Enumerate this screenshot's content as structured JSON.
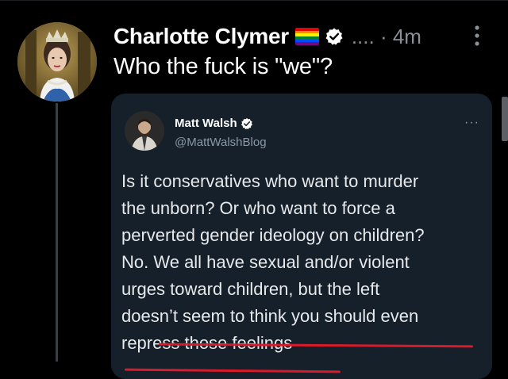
{
  "tweet": {
    "author_name": "Charlotte Clymer",
    "meta": ".... · 4m",
    "text": "Who the fuck is \"we\"?"
  },
  "quoted_tweet": {
    "author_name": "Matt Walsh",
    "handle": "@MattWalshBlog",
    "more": "···",
    "lines": [
      "Is it conservatives who want to murder",
      "the unborn? Or who want to force a",
      "perverted gender ideology on children?",
      "No. We all have sexual and/or violent",
      "urges toward children, but the left",
      "doesn’t seem to think you should even",
      "repress those feelings"
    ]
  },
  "colors": {
    "background": "#000000",
    "card_background": "#15202b",
    "verified_blue": "#1d9bf0",
    "muted_text": "#8b9096",
    "underline_red": "#d81b2a",
    "pride_flag": [
      "#e40303",
      "#ff8c00",
      "#ffed00",
      "#008026",
      "#004dff",
      "#750787"
    ]
  },
  "icons": {
    "author_verified": "verified-badge-icon",
    "author_flag": "pride-flag-icon",
    "more": "more-vertical-icon",
    "quoted_verified": "verified-badge-icon",
    "quoted_more": "more-horizontal-icon"
  }
}
